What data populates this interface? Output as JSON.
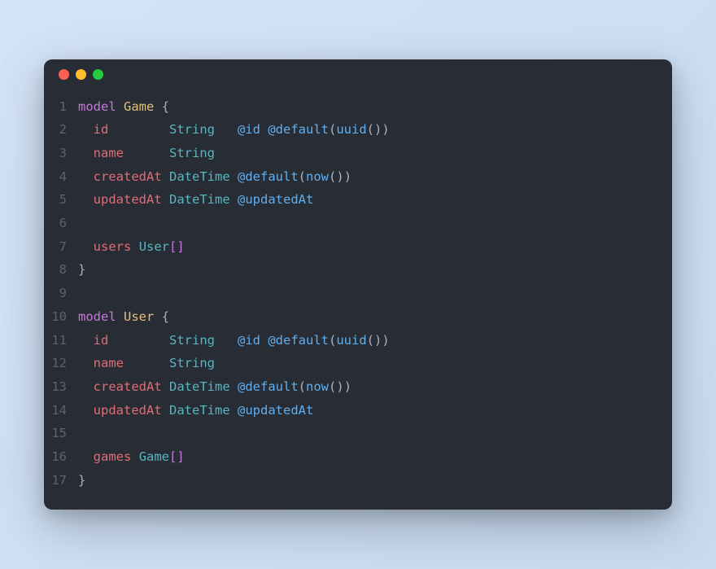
{
  "window": {
    "traffic_lights": [
      "red",
      "yellow",
      "green"
    ]
  },
  "syntax_colors": {
    "keyword": "#c678dd",
    "name": "#e5c07b",
    "field": "#e06c75",
    "type": "#56b6c2",
    "attr": "#61afef",
    "punct": "#abb2bf",
    "gutter": "#5c6370",
    "background": "#282c34"
  },
  "code": {
    "language": "prisma",
    "lines": [
      {
        "n": 1,
        "tokens": [
          {
            "t": "model",
            "c": "keyword"
          },
          {
            "t": " "
          },
          {
            "t": "Game",
            "c": "name"
          },
          {
            "t": " "
          },
          {
            "t": "{",
            "c": "brace"
          }
        ]
      },
      {
        "n": 2,
        "tokens": [
          {
            "t": "  "
          },
          {
            "t": "id",
            "c": "field"
          },
          {
            "t": "        "
          },
          {
            "t": "String",
            "c": "type"
          },
          {
            "t": "   "
          },
          {
            "t": "@id",
            "c": "attr"
          },
          {
            "t": " "
          },
          {
            "t": "@default",
            "c": "attr"
          },
          {
            "t": "(",
            "c": "punct"
          },
          {
            "t": "uuid",
            "c": "attr"
          },
          {
            "t": "(",
            "c": "punct"
          },
          {
            "t": ")",
            "c": "punct"
          },
          {
            "t": ")",
            "c": "punct"
          }
        ]
      },
      {
        "n": 3,
        "tokens": [
          {
            "t": "  "
          },
          {
            "t": "name",
            "c": "field"
          },
          {
            "t": "      "
          },
          {
            "t": "String",
            "c": "type"
          }
        ]
      },
      {
        "n": 4,
        "tokens": [
          {
            "t": "  "
          },
          {
            "t": "createdAt",
            "c": "field"
          },
          {
            "t": " "
          },
          {
            "t": "DateTime",
            "c": "type"
          },
          {
            "t": " "
          },
          {
            "t": "@default",
            "c": "attr"
          },
          {
            "t": "(",
            "c": "punct"
          },
          {
            "t": "now",
            "c": "attr"
          },
          {
            "t": "(",
            "c": "punct"
          },
          {
            "t": ")",
            "c": "punct"
          },
          {
            "t": ")",
            "c": "punct"
          }
        ]
      },
      {
        "n": 5,
        "tokens": [
          {
            "t": "  "
          },
          {
            "t": "updatedAt",
            "c": "field"
          },
          {
            "t": " "
          },
          {
            "t": "DateTime",
            "c": "type"
          },
          {
            "t": " "
          },
          {
            "t": "@updatedAt",
            "c": "attr"
          }
        ]
      },
      {
        "n": 6,
        "tokens": []
      },
      {
        "n": 7,
        "tokens": [
          {
            "t": "  "
          },
          {
            "t": "users",
            "c": "field"
          },
          {
            "t": " "
          },
          {
            "t": "User",
            "c": "type"
          },
          {
            "t": "[",
            "c": "bracket"
          },
          {
            "t": "]",
            "c": "bracket"
          }
        ]
      },
      {
        "n": 8,
        "tokens": [
          {
            "t": "}",
            "c": "brace"
          }
        ]
      },
      {
        "n": 9,
        "tokens": []
      },
      {
        "n": 10,
        "tokens": [
          {
            "t": "model",
            "c": "keyword"
          },
          {
            "t": " "
          },
          {
            "t": "User",
            "c": "name"
          },
          {
            "t": " "
          },
          {
            "t": "{",
            "c": "brace"
          }
        ]
      },
      {
        "n": 11,
        "tokens": [
          {
            "t": "  "
          },
          {
            "t": "id",
            "c": "field"
          },
          {
            "t": "        "
          },
          {
            "t": "String",
            "c": "type"
          },
          {
            "t": "   "
          },
          {
            "t": "@id",
            "c": "attr"
          },
          {
            "t": " "
          },
          {
            "t": "@default",
            "c": "attr"
          },
          {
            "t": "(",
            "c": "punct"
          },
          {
            "t": "uuid",
            "c": "attr"
          },
          {
            "t": "(",
            "c": "punct"
          },
          {
            "t": ")",
            "c": "punct"
          },
          {
            "t": ")",
            "c": "punct"
          }
        ]
      },
      {
        "n": 12,
        "tokens": [
          {
            "t": "  "
          },
          {
            "t": "name",
            "c": "field"
          },
          {
            "t": "      "
          },
          {
            "t": "String",
            "c": "type"
          }
        ]
      },
      {
        "n": 13,
        "tokens": [
          {
            "t": "  "
          },
          {
            "t": "createdAt",
            "c": "field"
          },
          {
            "t": " "
          },
          {
            "t": "DateTime",
            "c": "type"
          },
          {
            "t": " "
          },
          {
            "t": "@default",
            "c": "attr"
          },
          {
            "t": "(",
            "c": "punct"
          },
          {
            "t": "now",
            "c": "attr"
          },
          {
            "t": "(",
            "c": "punct"
          },
          {
            "t": ")",
            "c": "punct"
          },
          {
            "t": ")",
            "c": "punct"
          }
        ]
      },
      {
        "n": 14,
        "tokens": [
          {
            "t": "  "
          },
          {
            "t": "updatedAt",
            "c": "field"
          },
          {
            "t": " "
          },
          {
            "t": "DateTime",
            "c": "type"
          },
          {
            "t": " "
          },
          {
            "t": "@updatedAt",
            "c": "attr"
          }
        ]
      },
      {
        "n": 15,
        "tokens": []
      },
      {
        "n": 16,
        "tokens": [
          {
            "t": "  "
          },
          {
            "t": "games",
            "c": "field"
          },
          {
            "t": " "
          },
          {
            "t": "Game",
            "c": "type"
          },
          {
            "t": "[",
            "c": "bracket"
          },
          {
            "t": "]",
            "c": "bracket"
          }
        ]
      },
      {
        "n": 17,
        "tokens": [
          {
            "t": "}",
            "c": "brace"
          }
        ]
      }
    ]
  }
}
